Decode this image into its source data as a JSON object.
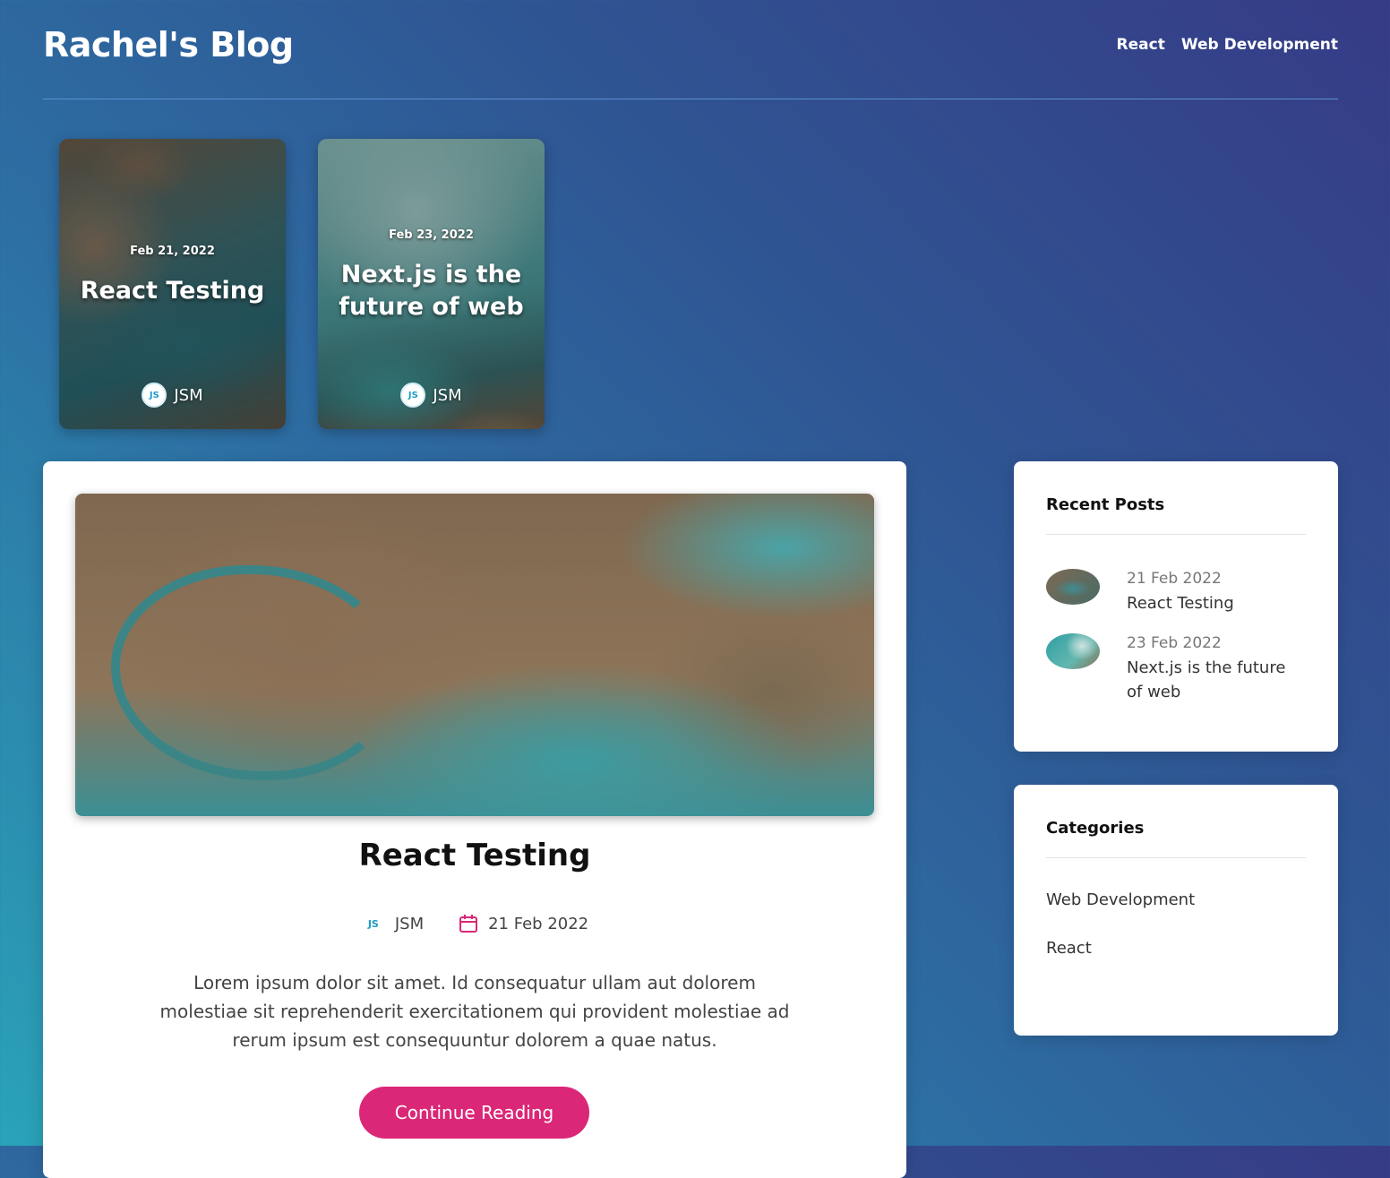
{
  "header": {
    "brand": "Rachel's Blog",
    "nav": [
      "React",
      "Web Development"
    ]
  },
  "featured": [
    {
      "date": "Feb 21, 2022",
      "title": "React Testing",
      "author": "JSM"
    },
    {
      "date": "Feb 23, 2022",
      "title": "Next.js is the future of web",
      "author": "JSM"
    }
  ],
  "post": {
    "title": "React Testing",
    "author": "JSM",
    "date": "21 Feb 2022",
    "excerpt": "Lorem ipsum dolor sit amet. Id consequatur ullam aut dolorem molestiae sit reprehenderit exercitationem qui provident molestiae ad rerum ipsum est consequuntur dolorem a quae natus.",
    "cta": "Continue Reading"
  },
  "recent_posts": {
    "title": "Recent Posts",
    "items": [
      {
        "date": "21 Feb 2022",
        "title": "React Testing"
      },
      {
        "date": "23 Feb 2022",
        "title": "Next.js is the future of web"
      }
    ]
  },
  "categories": {
    "title": "Categories",
    "items": [
      "Web Development",
      "React"
    ]
  },
  "avatar_glyph": "JS",
  "colors": {
    "accent": "#db2777",
    "calendar_icon": "#db2777"
  },
  "icons": {
    "calendar": "calendar-icon",
    "avatar": "jsm-avatar-icon"
  }
}
